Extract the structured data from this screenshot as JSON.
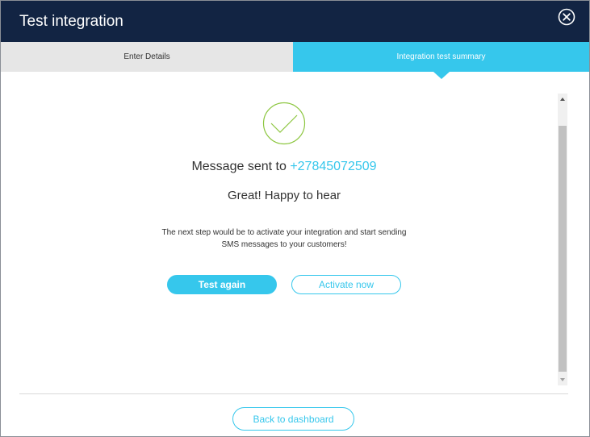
{
  "dialog": {
    "title": "Test integration"
  },
  "tabs": [
    {
      "label": "Enter Details",
      "active": false
    },
    {
      "label": "Integration test summary",
      "active": true
    }
  ],
  "result": {
    "sent_prefix": "Message sent to",
    "phone": "+27845072509",
    "headline": "Great! Happy to hear",
    "description_line1": "The next step would be to activate your integration and start sending",
    "description_line2": "SMS messages to your customers!"
  },
  "actions": {
    "test_again": "Test again",
    "activate_now": "Activate now"
  },
  "footer": {
    "back_label": "Back to dashboard"
  },
  "colors": {
    "header_bg": "#122443",
    "accent": "#36c7ec",
    "success_green": "#8cc63f",
    "inactive_tab_bg": "#e6e6e6"
  },
  "icons": {
    "close": "close-circle-icon",
    "success": "check-circle-icon",
    "scroll_up": "triangle-up-icon",
    "scroll_down": "triangle-down-icon"
  }
}
